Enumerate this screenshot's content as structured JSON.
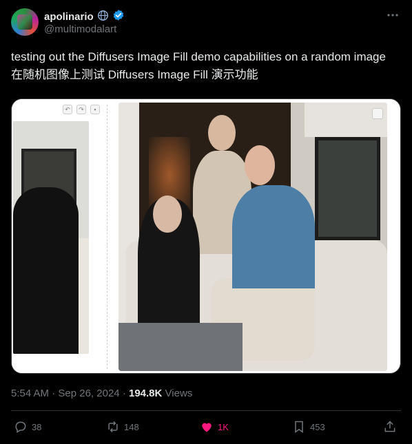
{
  "author": {
    "display_name": "apolinario",
    "handle": "@multimodalart",
    "badges": [
      "globe-icon",
      "verified-badge-icon"
    ]
  },
  "tweet": {
    "text_line1": "testing out the Diffusers Image Fill demo capabilities on a random image",
    "text_line2": "在随机图像上测试 Diffusers Image Fill 演示功能"
  },
  "meta": {
    "time": "5:54 AM",
    "dot": "·",
    "date": "Sep 26, 2024",
    "views_count": "194.8K",
    "views_label": "Views"
  },
  "actions": {
    "reply_count": "38",
    "retweet_count": "148",
    "like_count": "1K",
    "bookmark_count": "453"
  },
  "colors": {
    "background": "#000000",
    "text": "#e7e9ea",
    "muted": "#71767b",
    "verified": "#1d9bf0",
    "like_active": "#f91880"
  }
}
